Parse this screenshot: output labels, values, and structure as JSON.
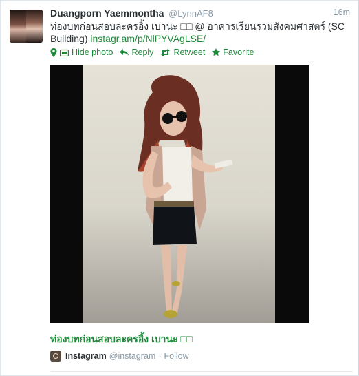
{
  "tweet": {
    "fullname": "Duangporn Yaemmontha",
    "username": "@LynnAF8",
    "time": "16m",
    "text_main": "ท่องบทก่อนสอบละครอิ้ง เบานะ □□ @ อาคารเรียนรวมสังคมศาสตร์ (SC Building) ",
    "link": "instagr.am/p/NlPYVAgLSE/"
  },
  "actions": {
    "hide_photo": "Hide photo",
    "reply": "Reply",
    "retweet": "Retweet",
    "favorite": "Favorite"
  },
  "card": {
    "title": "ท่องบทก่อนสอบละครอิ้ง เบานะ □□",
    "source_name": "Instagram",
    "source_handle": "@instagram",
    "separator": "·",
    "follow": "Follow"
  },
  "colors": {
    "link": "#1d8a3a",
    "meta": "#8899a6",
    "text": "#292f33"
  }
}
